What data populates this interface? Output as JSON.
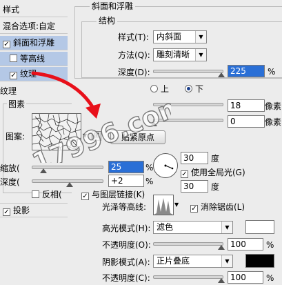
{
  "styles_panel": {
    "title": "样式",
    "items": [
      {
        "label": "混合选项:自定",
        "checkbox": false,
        "selected": false
      },
      {
        "label": "斜面和浮雕",
        "checkbox": true,
        "checked": true,
        "selected": true
      },
      {
        "label": "等高线",
        "checkbox": true,
        "checked": false,
        "selected": true
      },
      {
        "label": "纹理",
        "checkbox": true,
        "checked": true,
        "selected": true
      }
    ],
    "drop_shadow_label": "投影"
  },
  "bevel": {
    "group_title": "斜面和浮雕",
    "structure_title": "结构",
    "style_label": "样式(T):",
    "style_value": "内斜面",
    "technique_label": "方法(Q):",
    "technique_value": "雕刻清晰",
    "depth_label": "深度(D):",
    "depth_value": "225",
    "depth_unit": "%",
    "direction_up": "上",
    "direction_down": "下",
    "size_value": "18",
    "size_unit": "像素",
    "soften_value": "0",
    "soften_unit": "像素"
  },
  "texture": {
    "title": "纹理",
    "pattern_group": "图素",
    "pattern_label": "图案:",
    "snap_button": "贴紧原点",
    "scale_label": "缩放(",
    "scale_value": "25",
    "scale_unit": "%",
    "depth_label": "深度(",
    "depth_value": "+2",
    "depth_unit": "%",
    "invert_label": "反相(",
    "link_label": "与图层链接(K)"
  },
  "shading": {
    "angle_value": "30",
    "angle_unit": "度",
    "global_light_label": "使用全局光(G)",
    "altitude_value": "30",
    "altitude_unit": "度",
    "gloss_contour_label": "光泽等高线:",
    "antialias_label": "消除锯齿(L)",
    "highlight_mode_label": "高光模式(H):",
    "highlight_mode_value": "滤色",
    "highlight_color": "#ffffff",
    "highlight_opacity_label": "不透明度(O):",
    "highlight_opacity_value": "100",
    "highlight_opacity_unit": "%",
    "shadow_mode_label": "阴影模式(A):",
    "shadow_mode_value": "正片叠底",
    "shadow_color": "#000000",
    "shadow_opacity_label": "不透明度(C):",
    "shadow_opacity_value": "100",
    "shadow_opacity_unit": "%"
  },
  "watermark": {
    "text": "17996.com"
  },
  "colors": {
    "selection": "#b4c8e6",
    "arrow": "#e8101a",
    "field_highlight": "#2a6fd6"
  }
}
